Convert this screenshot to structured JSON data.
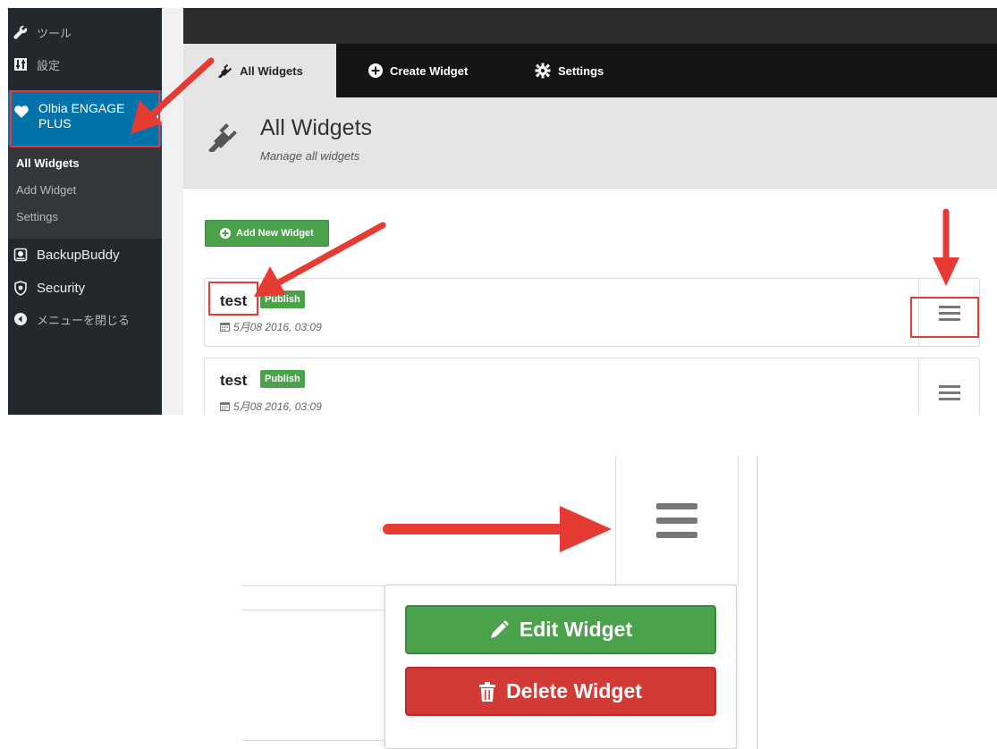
{
  "sidebar": {
    "items": [
      {
        "icon": "wrench-icon",
        "label": "ツール"
      },
      {
        "icon": "settings-icon",
        "label": "設定"
      },
      {
        "icon": "heart-icon",
        "label": "Olbia ENGAGE PLUS"
      },
      {
        "icon": "backup-icon",
        "label": "BackupBuddy"
      },
      {
        "icon": "shield-icon",
        "label": "Security"
      },
      {
        "icon": "collapse-icon",
        "label": "メニューを閉じる"
      }
    ],
    "submenu": [
      "All Widgets",
      "Add Widget",
      "Settings"
    ]
  },
  "plugin": {
    "tabs": [
      {
        "icon": "plug-icon",
        "label": "All Widgets"
      },
      {
        "icon": "plus-circle-icon",
        "label": "Create Widget"
      },
      {
        "icon": "gear-icon",
        "label": "Settings"
      }
    ],
    "header": {
      "title": "All Widgets",
      "subtitle": "Manage all widgets"
    },
    "add_button": "Add New Widget",
    "widgets": [
      {
        "name": "test",
        "status": "Publish",
        "date": "5月08 2016, 03:09"
      },
      {
        "name": "test",
        "status": "Publish",
        "date": "5月08 2016, 03:09"
      }
    ]
  },
  "dropdown": {
    "edit_label": "Edit Widget",
    "delete_label": "Delete Widget"
  },
  "colors": {
    "sidebar_bg": "#23282d",
    "sidebar_active": "#0073aa",
    "tabbar_bg": "#141414",
    "publish_green": "#4aa24a",
    "delete_red": "#d33a35",
    "annotation_red": "#e53b33"
  }
}
